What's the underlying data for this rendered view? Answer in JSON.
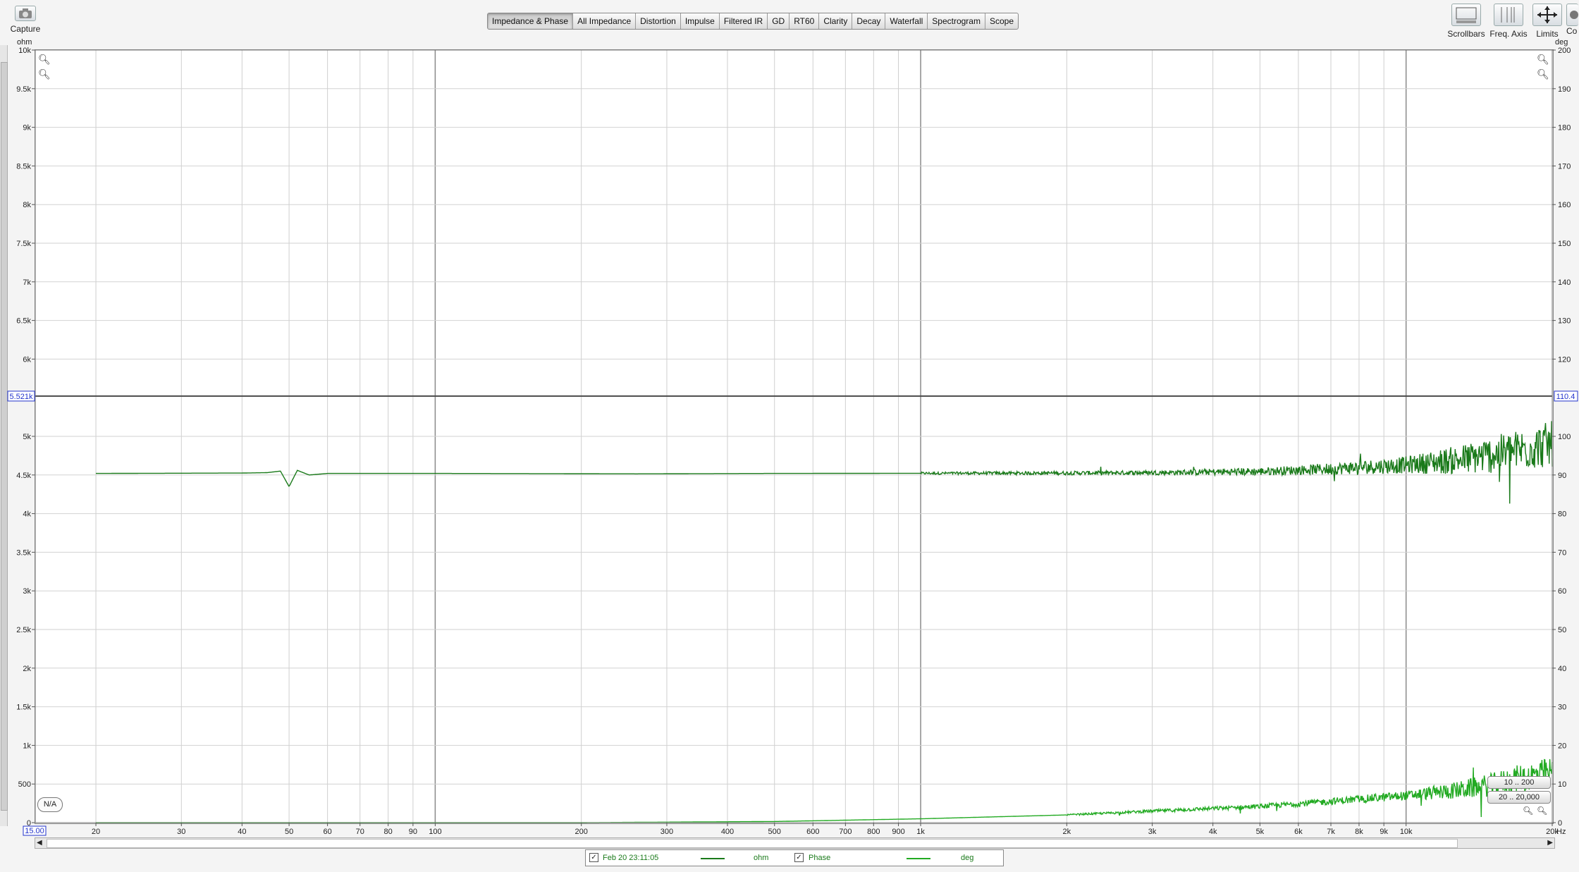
{
  "toolbar": {
    "capture_label": "Capture",
    "right_buttons": [
      {
        "label": "Scrollbars",
        "icon": "scrollbars-icon"
      },
      {
        "label": "Freq. Axis",
        "icon": "freq-axis-icon"
      },
      {
        "label": "Limits",
        "icon": "limits-icon"
      },
      {
        "label": "Co",
        "icon": "controls-icon"
      }
    ]
  },
  "tabs": [
    {
      "label": "Impedance & Phase",
      "active": true
    },
    {
      "label": "All Impedance"
    },
    {
      "label": "Distortion"
    },
    {
      "label": "Impulse"
    },
    {
      "label": "Filtered IR"
    },
    {
      "label": "GD"
    },
    {
      "label": "RT60"
    },
    {
      "label": "Clarity"
    },
    {
      "label": "Decay"
    },
    {
      "label": "Waterfall"
    },
    {
      "label": "Spectrogram"
    },
    {
      "label": "Scope"
    }
  ],
  "chart_data": {
    "type": "line",
    "x_scale": "log",
    "xlim": [
      15,
      20000
    ],
    "x_ticks": [
      20,
      30,
      40,
      50,
      60,
      70,
      80,
      90,
      100,
      200,
      300,
      400,
      500,
      600,
      700,
      800,
      900,
      1000,
      2000,
      3000,
      4000,
      5000,
      6000,
      7000,
      8000,
      9000,
      10000,
      20000
    ],
    "x_tick_labels": [
      "20",
      "30",
      "40",
      "50",
      "60",
      "70",
      "80",
      "90",
      "100",
      "200",
      "300",
      "400",
      "500",
      "600",
      "700",
      "800",
      "900",
      "1k",
      "2k",
      "3k",
      "4k",
      "5k",
      "6k",
      "7k",
      "8k",
      "9k",
      "10k",
      "20k"
    ],
    "x_unit": "Hz",
    "x_min_label": "15.00",
    "left_axis": {
      "unit": "ohm",
      "ylim": [
        0,
        10000
      ],
      "ticks": [
        0,
        500,
        1000,
        1500,
        2000,
        2500,
        3000,
        3500,
        4000,
        4500,
        5000,
        6000,
        6500,
        7000,
        7500,
        8000,
        8500,
        9000,
        9500,
        10000
      ],
      "tick_labels": [
        "0",
        "500",
        "1k",
        "1.5k",
        "2k",
        "2.5k",
        "3k",
        "3.5k",
        "4k",
        "4.5k",
        "5k",
        "6k",
        "6.5k",
        "7k",
        "7.5k",
        "8k",
        "8.5k",
        "9k",
        "9.5k",
        "10k"
      ]
    },
    "right_axis": {
      "unit": "deg",
      "ylim": [
        0,
        200
      ],
      "ticks": [
        0,
        10,
        20,
        30,
        40,
        50,
        60,
        70,
        80,
        90,
        100,
        120,
        130,
        140,
        150,
        160,
        170,
        180,
        190,
        200
      ],
      "tick_labels": [
        "0",
        "10",
        "20",
        "30",
        "40",
        "50",
        "60",
        "70",
        "80",
        "90",
        "100",
        "120",
        "130",
        "140",
        "150",
        "160",
        "170",
        "180",
        "190",
        "200"
      ]
    },
    "cursor": {
      "left_label": "5.521k",
      "right_label": "110.4",
      "value_ohm": 5521
    },
    "grid": true,
    "series": [
      {
        "name": "ohm",
        "axis": "left",
        "color": "#1a7a1a",
        "points": [
          [
            20,
            4520
          ],
          [
            40,
            4525
          ],
          [
            45,
            4530
          ],
          [
            48,
            4550
          ],
          [
            50,
            4350
          ],
          [
            52,
            4560
          ],
          [
            55,
            4500
          ],
          [
            60,
            4520
          ],
          [
            100,
            4520
          ],
          [
            150,
            4518
          ],
          [
            260,
            4515
          ],
          [
            500,
            4520
          ],
          [
            1000,
            4522
          ],
          [
            2000,
            4525
          ],
          [
            3000,
            4530
          ],
          [
            5000,
            4545
          ],
          [
            7000,
            4580
          ],
          [
            10000,
            4630
          ],
          [
            13000,
            4700
          ],
          [
            15000,
            4760
          ],
          [
            17000,
            4820
          ],
          [
            20000,
            4900
          ]
        ],
        "noise_from_hz": 1000,
        "noise_amplitude": [
          [
            1000,
            15
          ],
          [
            3000,
            30
          ],
          [
            6000,
            60
          ],
          [
            10000,
            110
          ],
          [
            15000,
            240
          ],
          [
            20000,
            300
          ]
        ]
      },
      {
        "name": "Phase",
        "axis": "right",
        "color": "#22aa22",
        "points": [
          [
            20,
            0
          ],
          [
            200,
            0
          ],
          [
            500,
            0.3
          ],
          [
            1000,
            1
          ],
          [
            2000,
            2
          ],
          [
            3000,
            3
          ],
          [
            5000,
            4.2
          ],
          [
            7000,
            5.5
          ],
          [
            10000,
            7
          ],
          [
            13000,
            8.5
          ],
          [
            15000,
            9.8
          ],
          [
            17000,
            11.5
          ],
          [
            20000,
            13
          ]
        ],
        "noise_from_hz": 2000,
        "noise_amplitude": [
          [
            2000,
            0.2
          ],
          [
            5000,
            0.6
          ],
          [
            10000,
            1.2
          ],
          [
            15000,
            3
          ],
          [
            20000,
            4
          ]
        ]
      }
    ]
  },
  "left_bottom_badge": "N/A",
  "range_buttons": {
    "top": "10 .. 200",
    "bottom": "20 .. 20,000"
  },
  "legend": {
    "date_label": "Feb 20 23:11:05",
    "ohm_label": "ohm",
    "phase_label": "Phase",
    "deg_label": "deg",
    "ohm_color": "#1a7a1a",
    "deg_color": "#22aa22"
  }
}
